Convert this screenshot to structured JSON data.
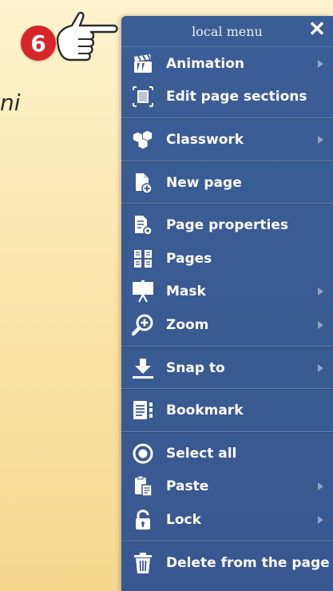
{
  "callout": {
    "number": "6"
  },
  "background": {
    "text": "ni"
  },
  "menu": {
    "title": "local menu",
    "close_label": "✕",
    "groups": [
      [
        {
          "label": "Animation",
          "icon": "clapperboard-icon",
          "submenu": true
        },
        {
          "label": "Edit page sections",
          "icon": "page-sections-icon",
          "submenu": false
        }
      ],
      [
        {
          "label": "Classwork",
          "icon": "classwork-icon",
          "submenu": true
        }
      ],
      [
        {
          "label": "New page",
          "icon": "new-page-icon",
          "submenu": false
        }
      ],
      [
        {
          "label": "Page properties",
          "icon": "page-properties-icon",
          "submenu": false
        },
        {
          "label": "Pages",
          "icon": "pages-grid-icon",
          "submenu": false
        },
        {
          "label": "Mask",
          "icon": "mask-icon",
          "submenu": true
        },
        {
          "label": "Zoom",
          "icon": "zoom-icon",
          "submenu": true
        }
      ],
      [
        {
          "label": "Snap to",
          "icon": "snap-download-icon",
          "submenu": true
        }
      ],
      [
        {
          "label": "Bookmark",
          "icon": "bookmark-icon",
          "submenu": false
        }
      ],
      [
        {
          "label": "Select all",
          "icon": "select-all-icon",
          "submenu": false
        },
        {
          "label": "Paste",
          "icon": "paste-icon",
          "submenu": true
        },
        {
          "label": "Lock",
          "icon": "lock-icon",
          "submenu": true
        }
      ],
      [
        {
          "label": "Delete from the page",
          "icon": "trash-icon",
          "submenu": false
        }
      ]
    ]
  }
}
